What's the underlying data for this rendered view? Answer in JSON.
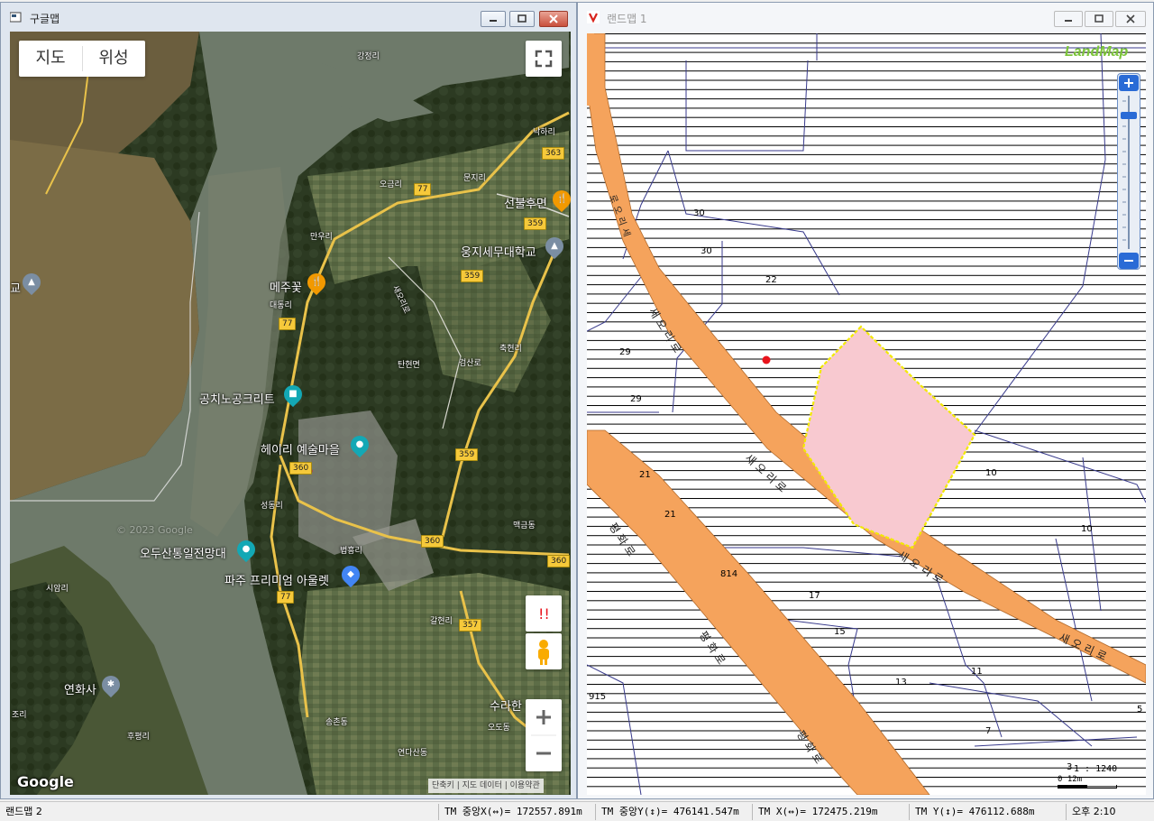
{
  "left_window": {
    "title": "구글맵",
    "map_type_tabs": [
      "지도",
      "위성"
    ],
    "google_logo": "Google",
    "watermark": "© 2023 Google",
    "attribution": [
      "단축키",
      "지도 데이터",
      "이용약관"
    ],
    "places": {
      "gangjeong": "강정리",
      "nakha": "낙하리",
      "ogeum": "오금리",
      "munji": "문지리",
      "seonbul": "선불후면",
      "manwu": "만우리",
      "ungji": "웅지세무대학교",
      "mejugot": "메주꽃",
      "daedong": "대동리",
      "saeori": "새오리로",
      "tanhyeon": "탄현면",
      "chuk": "축현리",
      "geomsan": "검산로",
      "gongchi": "공치노공크리트",
      "heyri": "헤이리 예술마을",
      "seongdong": "성동리",
      "maekgeum": "맥금동",
      "odusan": "오두산통일전망대",
      "beopheung": "법흥리",
      "paju_outlet": "파주 프리미엄 아울렛",
      "siam": "시암리",
      "galhyeon": "갈현리",
      "yeonhwa": "연화사",
      "surahan": "수라한",
      "songchon": "송촌동",
      "odo": "오도동",
      "hubyeong": "후평리",
      "yeonda": "연다산동",
      "jori": "조리",
      "left_edge": "교"
    },
    "road_numbers": [
      "363",
      "77",
      "359",
      "359",
      "77",
      "359",
      "360",
      "360",
      "360",
      "77",
      "357"
    ]
  },
  "right_window": {
    "title": "랜드맵 1",
    "logo": "LandMap",
    "parcel_numbers": [
      "30",
      "30",
      "22",
      "29",
      "29",
      "21",
      "21",
      "10",
      "10",
      "814",
      "17",
      "15",
      "13",
      "11",
      "915",
      "7",
      "5",
      "3"
    ],
    "road_labels": {
      "saeori_upper": "새오리로",
      "saeori_mid": "새오리로",
      "saeori_low": "새오리로",
      "saeori_right": "새오리로",
      "pyeonghwa_upper": "평화로",
      "pyeonghwa_mid": "평화로",
      "pyeonghwa_low": "평화로",
      "left_top": "로오리세"
    },
    "scale": {
      "ratio": "1 : 1240",
      "bar_label": "0  12m"
    },
    "parcel_fill_color": "#f8c9d0",
    "parcel_outline_color": "#f2ea00",
    "road_color": "#f5a35c"
  },
  "status_bar": {
    "app_name": "랜드맵 2",
    "tm_center_x": "TM 중앙X(↔)= 172557.891m",
    "tm_center_y": "TM 중앙Y(↕)= 476141.547m",
    "tm_x": "TM X(↔)= 172475.219m",
    "tm_y": "TM Y(↕)= 476112.688m",
    "time": "오후 2:10"
  }
}
